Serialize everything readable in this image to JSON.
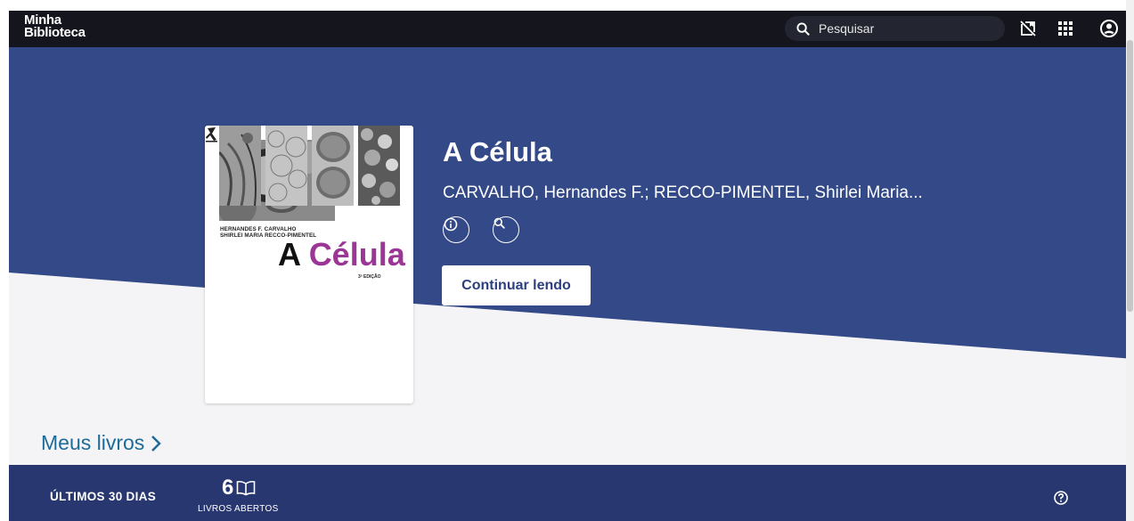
{
  "app": {
    "logo_line1": "Minha",
    "logo_line2": "Biblioteca"
  },
  "search": {
    "placeholder": "Pesquisar"
  },
  "topbar_icons": [
    "book-off-icon",
    "apps-grid-icon",
    "account-circle-icon"
  ],
  "book": {
    "title": "A Célula",
    "authors": "CARVALHO, Hernandes F.; RECCO-PIMENTEL, Shirlei Maria...",
    "cover": {
      "author1": "HERNANDES F. CARVALHO",
      "author2": "SHIRLEI MARIA RECCO-PIMENTEL",
      "title_prefix": "A",
      "title_accent": "Célula",
      "edition": "3ª EDIÇÃO",
      "accent_color": "#9b3596"
    },
    "continue_label": "Continuar lendo",
    "action_icons": [
      "info-icon",
      "search-icon"
    ]
  },
  "my_books": {
    "label": "Meus livros"
  },
  "stats": {
    "period_label": "ÚLTIMOS 30 DIAS",
    "count": "6",
    "count_label": "LIVROS ABERTOS"
  },
  "colors": {
    "topbar": "#15161d",
    "hero_blue": "#344a88",
    "stats_bar": "#283770",
    "link": "#1d6b98"
  }
}
